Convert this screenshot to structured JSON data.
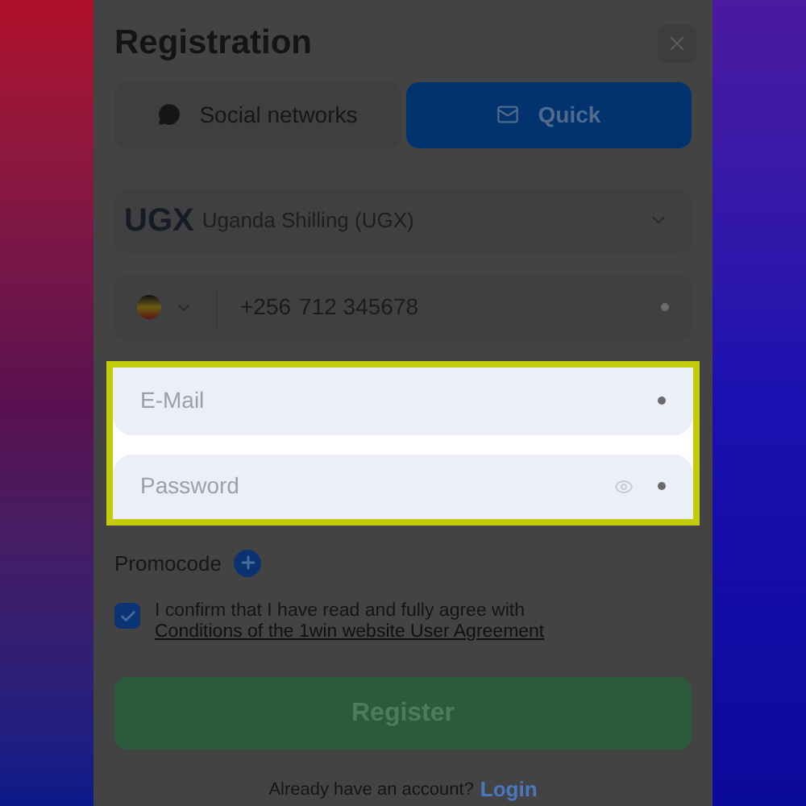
{
  "dialog": {
    "title": "Registration"
  },
  "tabs": [
    {
      "label": "Social networks",
      "kind": "chat",
      "selected": false
    },
    {
      "label": "Quick",
      "kind": "mail",
      "selected": true
    }
  ],
  "currency": {
    "code": "UGX",
    "name": "Uganda Shilling (UGX)"
  },
  "phone": {
    "prefix": "+256",
    "placeholder": "712 345678"
  },
  "email": {
    "placeholder": "E-Mail"
  },
  "password": {
    "placeholder": "Password"
  },
  "promocode": {
    "label": "Promocode"
  },
  "agreement": {
    "checked": true,
    "text": "I confirm that I have read and fully agree with",
    "link": "Conditions of the 1win website User Agreement"
  },
  "register_button": "Register",
  "login": {
    "prompt": "Already have an account?",
    "link": "Login"
  }
}
